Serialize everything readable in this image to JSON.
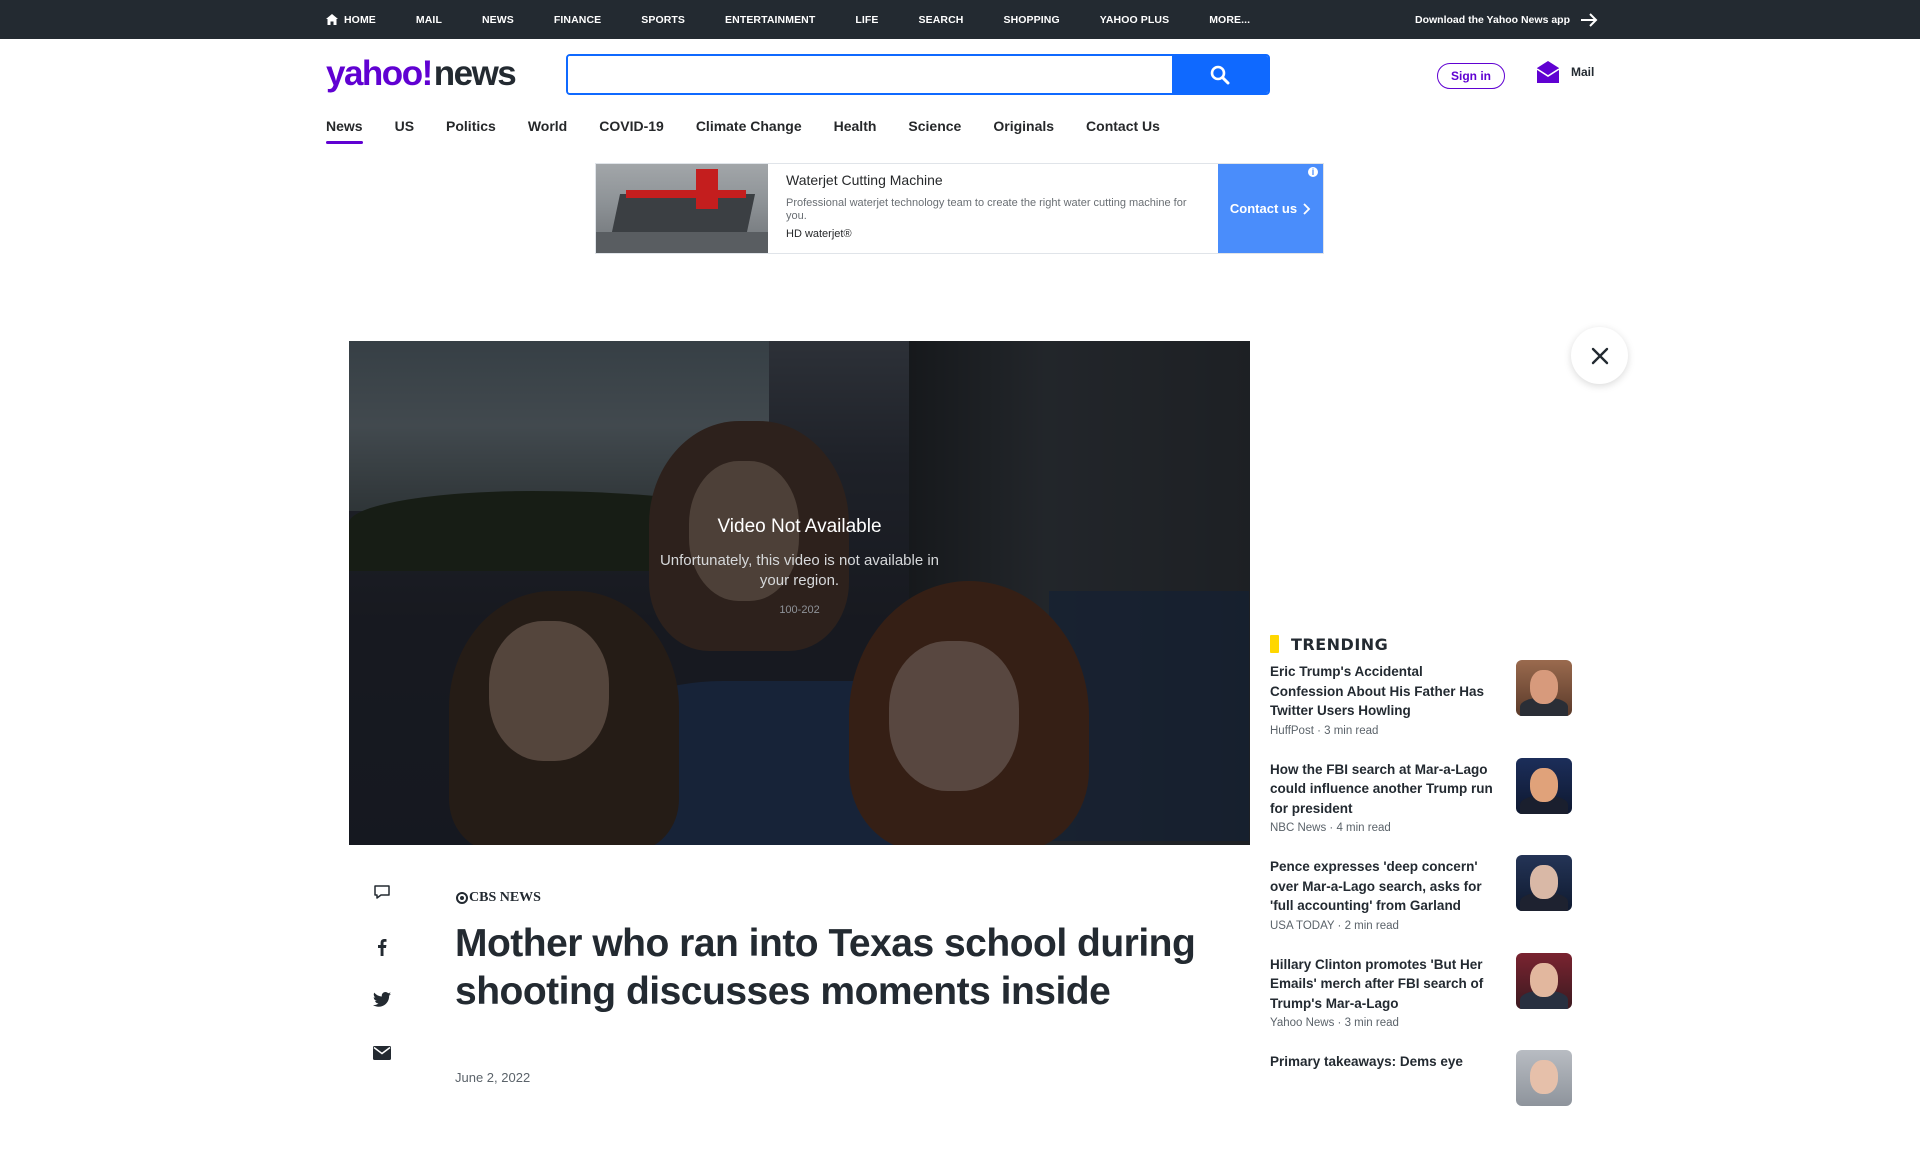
{
  "topnav": {
    "items": [
      "HOME",
      "MAIL",
      "NEWS",
      "FINANCE",
      "SPORTS",
      "ENTERTAINMENT",
      "LIFE",
      "SEARCH",
      "SHOPPING",
      "YAHOO PLUS",
      "MORE..."
    ],
    "download_app": "Download the Yahoo News app"
  },
  "header": {
    "logo_yahoo": "yahoo!",
    "logo_news": "news",
    "search_value": "",
    "sign_in": "Sign in",
    "mail": "Mail"
  },
  "subnav": {
    "items": [
      "News",
      "US",
      "Politics",
      "World",
      "COVID-19",
      "Climate Change",
      "Health",
      "Science",
      "Originals",
      "Contact Us"
    ],
    "active": "News"
  },
  "ad": {
    "title": "Waterjet Cutting Machine",
    "description": "Professional waterjet technology team to create the right water cutting machine for you.",
    "source": "HD waterjet®",
    "cta": "Contact us"
  },
  "video": {
    "title": "Video Not Available",
    "description": "Unfortunately, this video is not available in your region.",
    "code": "100-202"
  },
  "article": {
    "source": "CBS NEWS",
    "headline": "Mother who ran into Texas school during shooting discusses moments inside",
    "date": "June 2, 2022"
  },
  "trending": {
    "title": "TRENDING",
    "items": [
      {
        "headline": "Eric Trump's Accidental Confession About His Father Has Twitter Users Howling",
        "meta": "HuffPost · 3 min read"
      },
      {
        "headline": "How the FBI search at Mar-a-Lago could influence another Trump run for president",
        "meta": "NBC News · 4 min read"
      },
      {
        "headline": "Pence expresses 'deep concern' over Mar-a-Lago search, asks for 'full accounting' from Garland",
        "meta": "USA TODAY · 2 min read"
      },
      {
        "headline": "Hillary Clinton promotes 'But Her Emails' merch after FBI search of Trump's Mar-a-Lago",
        "meta": "Yahoo News · 3 min read"
      },
      {
        "headline": "Primary takeaways: Dems eye",
        "meta": ""
      }
    ]
  },
  "colors": {
    "topbar": "#232a31",
    "brand_purple": "#6001d2",
    "search_blue": "#0f69ff",
    "trending_yellow": "#ffd700"
  }
}
